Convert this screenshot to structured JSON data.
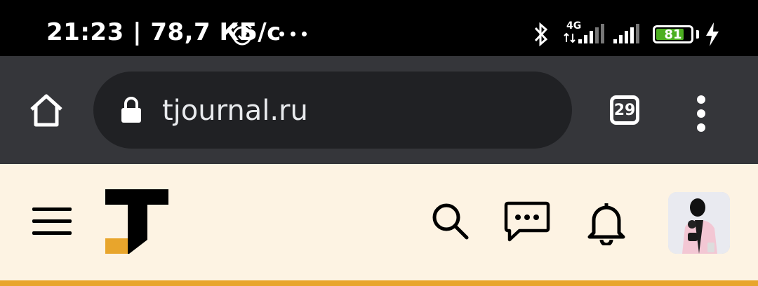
{
  "status_bar": {
    "time_speed": "21:23 | 78,7 КБ/с",
    "network_type": "4G",
    "battery_percent": "81",
    "battery_level": 0.81,
    "icons": [
      "alarm-icon",
      "more-notifications-icon",
      "bluetooth-icon",
      "cell-signal-icon",
      "cell-signal-icon",
      "battery-icon",
      "charging-icon"
    ]
  },
  "browser": {
    "url": "tjournal.ru",
    "tab_count": "29",
    "icons": [
      "home-icon",
      "lock-icon",
      "tabs-icon",
      "more-menu-icon"
    ]
  },
  "site_header": {
    "icons": [
      "hamburger-menu-icon",
      "tjournal-logo",
      "search-icon",
      "messages-icon",
      "bell-icon",
      "avatar"
    ]
  },
  "colors": {
    "status_bar_bg": "#000000",
    "browser_bar_bg": "#35363a",
    "url_box_bg": "#202124",
    "page_bg": "#fdf3e3",
    "logo_accent": "#e8a52c",
    "battery_fill": "#4caf20"
  }
}
